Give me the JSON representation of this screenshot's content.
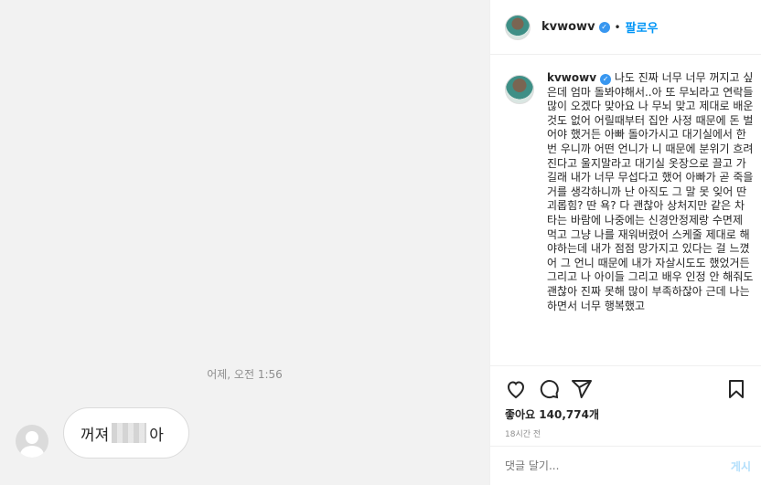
{
  "image": {
    "timestamp": "어제, 오전 1:56",
    "message_prefix": "꺼져",
    "message_suffix": "아"
  },
  "post": {
    "username": "kvwowv",
    "follow_label": "팔로우",
    "dot": "•",
    "verified_icon": "✓",
    "caption_username": "kvwowv",
    "caption_text": " 나도 진짜 너무 너무 꺼지고 싶은데 엄마 돌봐야해서..아 또 무뇌라고 연락들 많이 오겠다 맞아요 나 무뇌 맞고 제대로 배운것도 없어 어릴때부터 집안 사정 때문에 돈 벌어야 했거든 아빠 돌아가시고 대기실에서 한번 우니까 어떤 언니가 니 때문에 분위기 흐려진다고 울지말라고 대기실 옷장으로 끌고 가길래 내가 너무 무섭다고 했어 아빠가 곧 죽을거를 생각하니까 난 아직도 그 말 못 잊어 딴 괴롭힘? 딴 욕? 다 괜찮아 상처지만 같은 차 타는 바람에 나중에는 신경안정제랑 수면제 먹고 그냥 나를 재워버렸어 스케줄 제대로 해야하는데 내가 점점 망가지고 있다는 걸 느꼈어 그 언니 때문에 내가 자살시도도 했었거든\n그리고 나 아이들 그리고 배우 인정 안 해줘도 괜찮아 진짜 못해 많이 부족하잖아 근데 나는 하면서 너무 행복했고",
    "likes_label": "좋아요 140,774개",
    "age": "18시간 전",
    "comment_placeholder": "댓글 달기...",
    "post_label": "게시"
  },
  "icons": [
    "heart-icon",
    "comment-icon",
    "share-icon",
    "bookmark-icon",
    "verified-icon",
    "default-avatar-icon"
  ],
  "colors": {
    "accent": "#0095f6",
    "verified": "#3897f0",
    "muted": "#8e8e8e"
  }
}
